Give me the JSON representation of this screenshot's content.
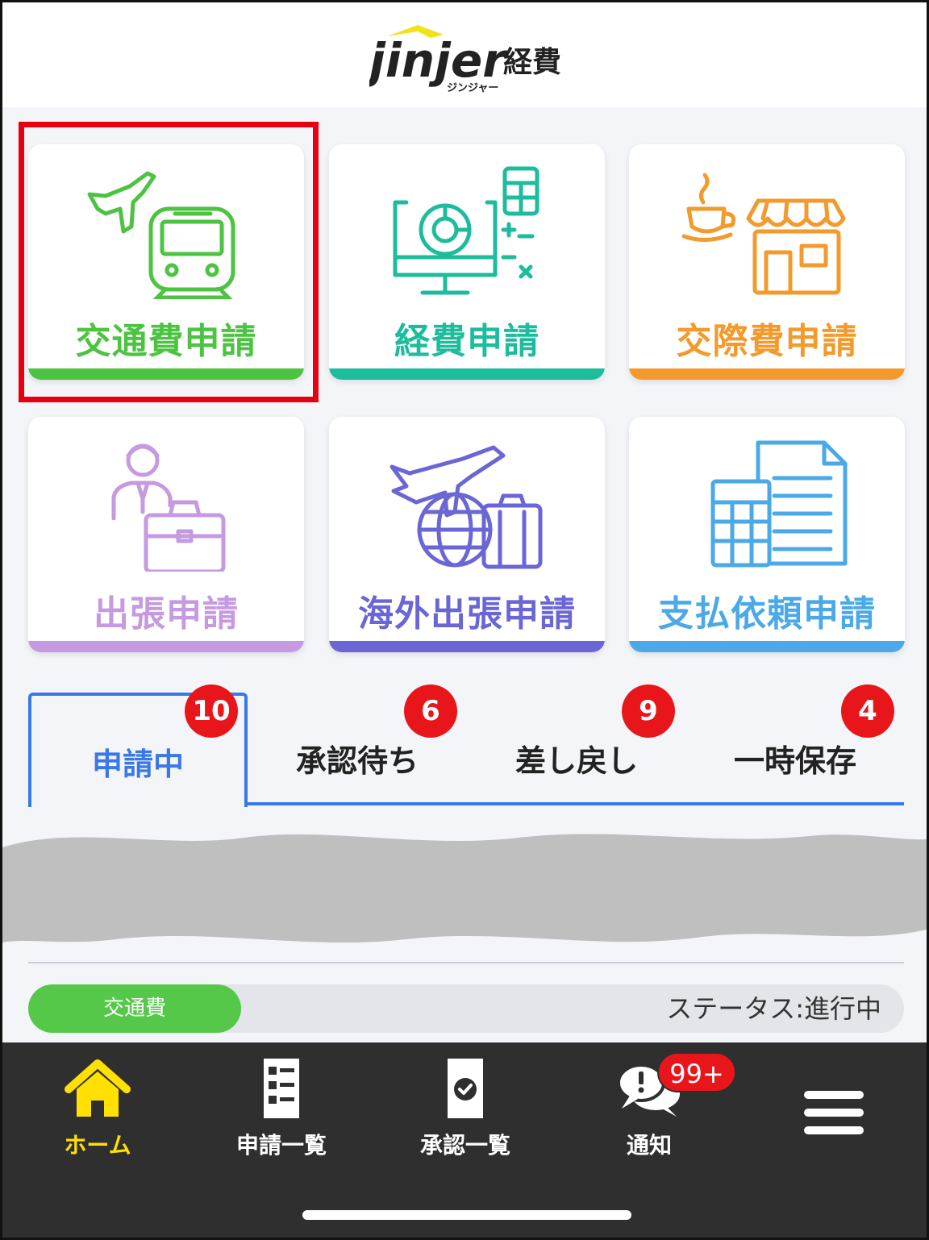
{
  "header": {
    "logo_text": "jinjer",
    "logo_suffix": "経費",
    "logo_subtitle": "ジンジャー"
  },
  "tiles": [
    {
      "label": "交通費申請",
      "color": "#4cc341",
      "icon": "plane-train-icon"
    },
    {
      "label": "経費申請",
      "color": "#1dbc9c",
      "icon": "monitor-calculator-icon"
    },
    {
      "label": "交際費申請",
      "color": "#f39a2c",
      "icon": "coffee-shop-icon"
    },
    {
      "label": "出張申請",
      "color": "#c59ae0",
      "icon": "businessman-briefcase-icon"
    },
    {
      "label": "海外出張申請",
      "color": "#6a66d6",
      "icon": "plane-globe-suitcase-icon"
    },
    {
      "label": "支払依頼申請",
      "color": "#4aa9e6",
      "icon": "calculator-document-icon"
    }
  ],
  "tabs": [
    {
      "label": "申請中",
      "badge": "10",
      "active": true
    },
    {
      "label": "承認待ち",
      "badge": "6",
      "active": false
    },
    {
      "label": "差し戻し",
      "badge": "9",
      "active": false
    },
    {
      "label": "一時保存",
      "badge": "4",
      "active": false
    }
  ],
  "list": {
    "category_pill": "交通費",
    "status": "ステータス:進行中"
  },
  "nav": [
    {
      "label": "ホーム",
      "icon": "home-icon",
      "active": true
    },
    {
      "label": "申請一覧",
      "icon": "list-document-icon",
      "active": false
    },
    {
      "label": "承認一覧",
      "icon": "approved-document-icon",
      "active": false
    },
    {
      "label": "通知",
      "icon": "notification-chat-icon",
      "active": false,
      "badge": "99+"
    },
    {
      "label": "",
      "icon": "hamburger-menu-icon",
      "active": false
    }
  ],
  "colors": {
    "accent_blue": "#3b78e7",
    "badge_red": "#e8161b",
    "nav_bg": "#2f2f2f",
    "nav_active": "#ffe000",
    "highlight": "#e60012"
  }
}
